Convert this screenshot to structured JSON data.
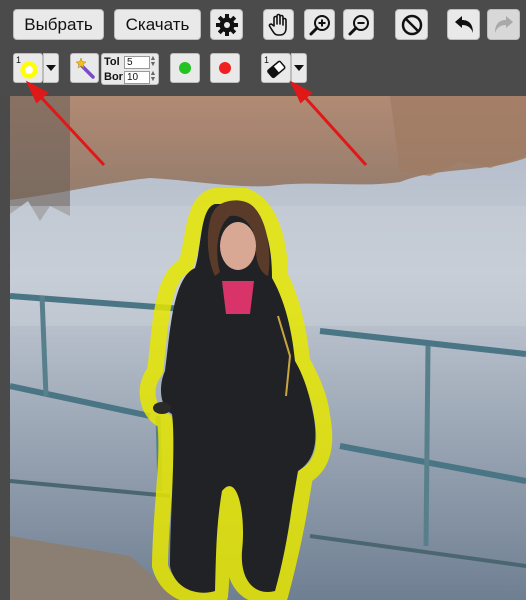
{
  "toolbar": {
    "choose_label": "Выбрать",
    "download_label": "Скачать",
    "brush_size": "1",
    "eraser_size": "1",
    "tol_label": "Tol",
    "bor_label": "Bor",
    "tol_value": "5",
    "bor_value": "10"
  },
  "colors": {
    "highlight": "#ffff00",
    "green_dot": "#22c322",
    "red_dot": "#f02020",
    "arrow": "#e01818",
    "toolbar_bg": "#4b4b4b",
    "button_bg": "#e9e9e9"
  },
  "icons": [
    "gear-icon",
    "hand-icon",
    "zoom-in-icon",
    "zoom-out-icon",
    "clear-icon",
    "undo-icon",
    "redo-icon",
    "magic-wand-icon",
    "eraser-icon"
  ]
}
